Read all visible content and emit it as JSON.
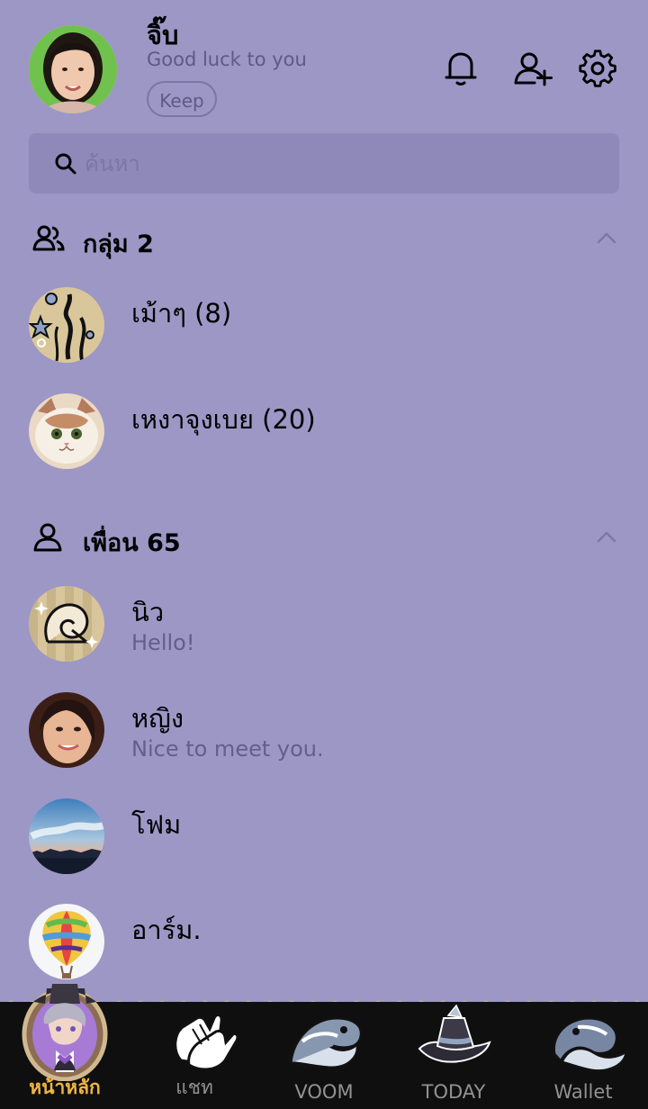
{
  "profile": {
    "name": "จิ๊บ",
    "status": "Good luck to you",
    "keep_label": "Keep"
  },
  "search": {
    "placeholder": "ค้นหา"
  },
  "sections": {
    "groups": {
      "title": "กลุ่ม 2",
      "items": [
        {
          "name": "เม้าๆ (8)"
        },
        {
          "name": "เหงาจุงเบย (20)"
        }
      ]
    },
    "friends": {
      "title": "เพื่อน 65",
      "items": [
        {
          "name": "นิว",
          "status": "Hello!"
        },
        {
          "name": "หญิง",
          "status": "Nice to meet you."
        },
        {
          "name": "โฟม",
          "status": ""
        },
        {
          "name": "อาร์ม.",
          "status": ""
        }
      ]
    }
  },
  "tabs": [
    {
      "label": "หน้าหลัก",
      "active": true
    },
    {
      "label": "แชท",
      "active": false
    },
    {
      "label": "VOOM",
      "active": false
    },
    {
      "label": "TODAY",
      "active": false
    },
    {
      "label": "Wallet",
      "active": false
    }
  ],
  "colors": {
    "background": "#9d97c6",
    "search_background": "#8f89ba",
    "tabbar_background": "#0f0f0f",
    "active_tab": "#f0b641",
    "inactive_tab": "#929292"
  },
  "icons": {
    "notification": "bell-icon",
    "add_friend": "add-friend-icon",
    "settings": "gear-icon",
    "search": "search-icon",
    "groups": "groups-icon",
    "friends": "person-icon",
    "collapse": "chevron-up-icon"
  }
}
